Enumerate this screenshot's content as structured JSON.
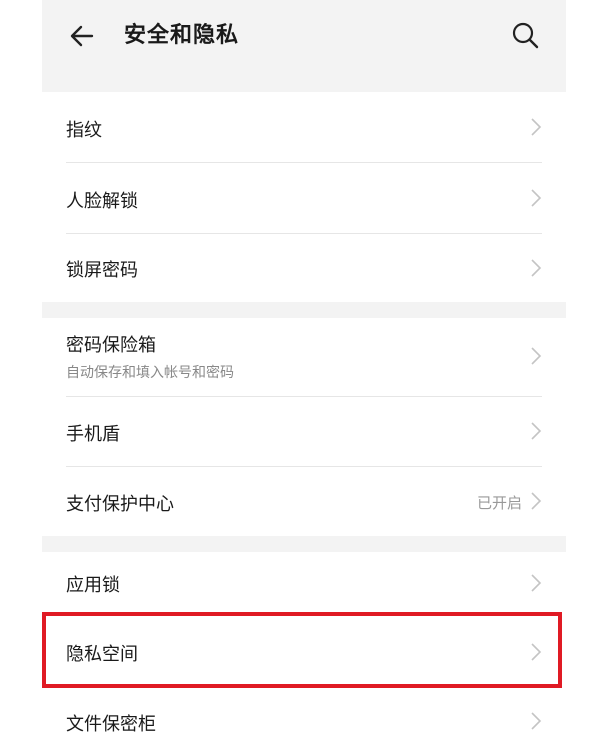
{
  "header": {
    "title": "安全和隐私",
    "back_icon": "arrow-left-icon",
    "search_icon": "search-icon"
  },
  "groups": [
    {
      "items": [
        {
          "label": "指纹"
        },
        {
          "label": "人脸解锁"
        },
        {
          "label": "锁屏密码"
        }
      ]
    },
    {
      "items": [
        {
          "label": "密码保险箱",
          "sublabel": "自动保存和填入帐号和密码"
        },
        {
          "label": "手机盾"
        },
        {
          "label": "支付保护中心",
          "status": "已开启"
        }
      ]
    },
    {
      "items": [
        {
          "label": "应用锁"
        },
        {
          "label": "隐私空间",
          "highlighted": true
        },
        {
          "label": "文件保密柜"
        }
      ]
    }
  ],
  "colors": {
    "highlight": "#e01a24",
    "background_gap": "#f3f3f3",
    "chevron": "#c4c4c4"
  }
}
